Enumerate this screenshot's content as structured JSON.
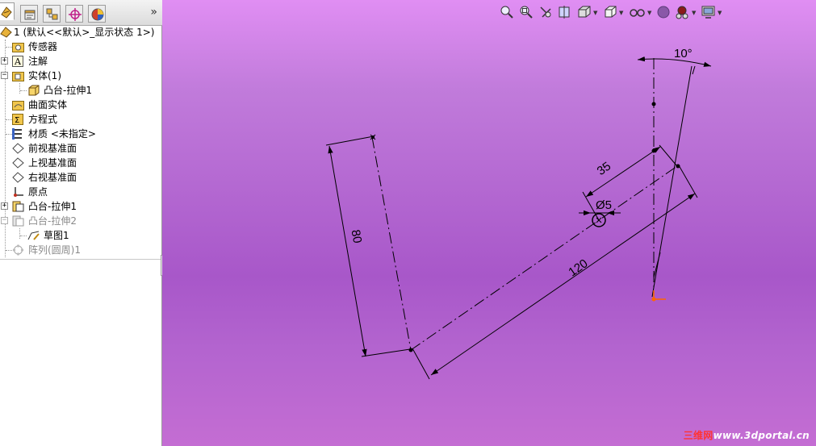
{
  "panel": {
    "tabs": [
      {
        "icon": "feature-manager-icon",
        "active": true
      },
      {
        "icon": "property-manager-icon",
        "active": false
      },
      {
        "icon": "configuration-manager-icon",
        "active": false
      },
      {
        "icon": "dimxpert-icon",
        "active": false
      },
      {
        "icon": "display-manager-icon",
        "active": false
      }
    ],
    "expand_label": "»"
  },
  "tree": {
    "root": {
      "label": "1   (默认<<默认>_显示状态 1>)",
      "icon": "part-icon"
    },
    "items": [
      {
        "label": "传感器",
        "icon": "sensor-folder-icon"
      },
      {
        "label": "注解",
        "icon": "annotation-icon"
      },
      {
        "label": "实体(1)",
        "icon": "solid-bodies-folder-icon"
      },
      {
        "label": "凸台-拉伸1",
        "icon": "solid-body-icon"
      },
      {
        "label": "曲面实体",
        "icon": "surface-bodies-folder-icon"
      },
      {
        "label": "方程式",
        "icon": "equations-icon"
      },
      {
        "label": "材质 <未指定>",
        "icon": "material-icon"
      },
      {
        "label": "前视基准面",
        "icon": "plane-icon"
      },
      {
        "label": "上视基准面",
        "icon": "plane-icon"
      },
      {
        "label": "右视基准面",
        "icon": "plane-icon"
      },
      {
        "label": "原点",
        "icon": "origin-icon"
      },
      {
        "label": "凸台-拉伸1",
        "icon": "extrude-icon"
      },
      {
        "label": "凸台-拉伸2",
        "icon": "extrude-icon",
        "suppressed": true
      },
      {
        "label": "草图1",
        "icon": "sketch-icon"
      },
      {
        "label": "阵列(圆周)1",
        "icon": "circular-pattern-icon",
        "suppressed": true
      }
    ]
  },
  "toolbar": {
    "buttons": [
      {
        "name": "zoom-to-fit-icon"
      },
      {
        "name": "zoom-to-area-icon"
      },
      {
        "name": "previous-view-icon"
      },
      {
        "name": "section-view-icon"
      },
      {
        "name": "view-orientation-icon",
        "dropdown": true
      },
      {
        "name": "display-style-icon",
        "dropdown": true
      },
      {
        "name": "hide-show-items-icon",
        "dropdown": true
      },
      {
        "name": "edit-appearance-icon"
      },
      {
        "name": "apply-scene-icon",
        "dropdown": true
      },
      {
        "name": "view-settings-icon",
        "dropdown": true
      }
    ]
  },
  "sketch": {
    "dimensions": {
      "angle": "10°",
      "short_length": "35",
      "diameter": "Ø5",
      "long_length": "120",
      "side_length": "80"
    }
  },
  "watermark": {
    "cn": "三维网",
    "url": "www.3dportal.cn"
  },
  "colors": {
    "viewport_top": "#e08ef3",
    "viewport_mid": "#a857c9",
    "sketch_line": "#000000",
    "origin": "#ff6600",
    "watermark_cn": "#ff3333"
  }
}
